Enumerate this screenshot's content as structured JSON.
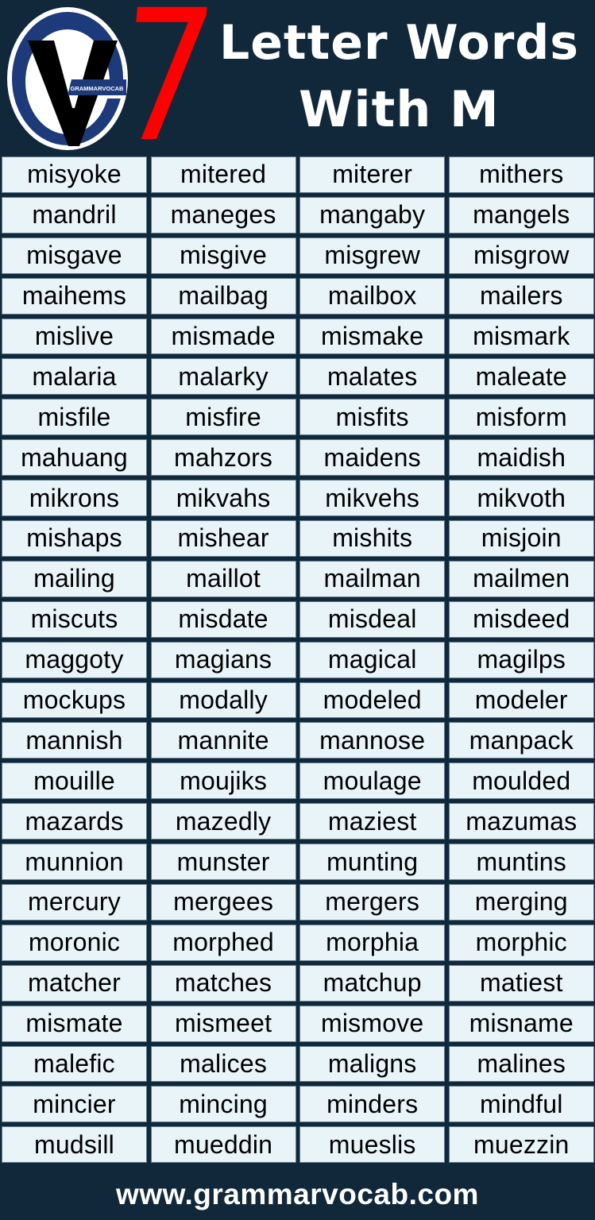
{
  "header": {
    "number": "7",
    "title_line1": "Letter Words",
    "title_line2": "With M",
    "logo_text": "GRAMMARVOCAB"
  },
  "colors": {
    "background": "#11283b",
    "cell_background": "#e9f4f9",
    "cell_border": "#5f7a8c",
    "accent_red": "#ff0000",
    "logo_blue": "#1d3a7a",
    "text": "#000000",
    "title_text": "#ffffff"
  },
  "words": [
    [
      "misyoke",
      "mitered",
      "miterer",
      "mithers"
    ],
    [
      "mandril",
      "maneges",
      "mangaby",
      "mangels"
    ],
    [
      "misgave",
      "misgive",
      "misgrew",
      "misgrow"
    ],
    [
      "maihems",
      "mailbag",
      "mailbox",
      "mailers"
    ],
    [
      "mislive",
      "mismade",
      "mismake",
      "mismark"
    ],
    [
      "malaria",
      "malarky",
      "malates",
      "maleate"
    ],
    [
      "misfile",
      "misfire",
      "misfits",
      "misform"
    ],
    [
      "mahuang",
      "mahzors",
      "maidens",
      "maidish"
    ],
    [
      "mikrons",
      "mikvahs",
      "mikvehs",
      "mikvoth"
    ],
    [
      "mishaps",
      "mishear",
      "mishits",
      "misjoin"
    ],
    [
      "mailing",
      "maillot",
      "mailman",
      "mailmen"
    ],
    [
      "miscuts",
      "misdate",
      "misdeal",
      "misdeed"
    ],
    [
      "maggoty",
      "magians",
      "magical",
      "magilps"
    ],
    [
      "mockups",
      "modally",
      "modeled",
      "modeler"
    ],
    [
      "mannish",
      "mannite",
      "mannose",
      "manpack"
    ],
    [
      "mouille",
      "moujiks",
      "moulage",
      "moulded"
    ],
    [
      "mazards",
      "mazedly",
      "maziest",
      "mazumas"
    ],
    [
      "munnion",
      "munster",
      "munting",
      "muntins"
    ],
    [
      "mercury",
      "mergees",
      "mergers",
      "merging"
    ],
    [
      "moronic",
      "morphed",
      "morphia",
      "morphic"
    ],
    [
      "matcher",
      "matches",
      "matchup",
      "matiest"
    ],
    [
      "mismate",
      "mismeet",
      "mismove",
      "misname"
    ],
    [
      "malefic",
      "malices",
      "maligns",
      "malines"
    ],
    [
      "mincier",
      "mincing",
      "minders",
      "mindful"
    ],
    [
      "mudsill",
      "mueddin",
      "mueslis",
      "muezzin"
    ]
  ],
  "footer": {
    "url": "www.grammarvocab.com"
  }
}
